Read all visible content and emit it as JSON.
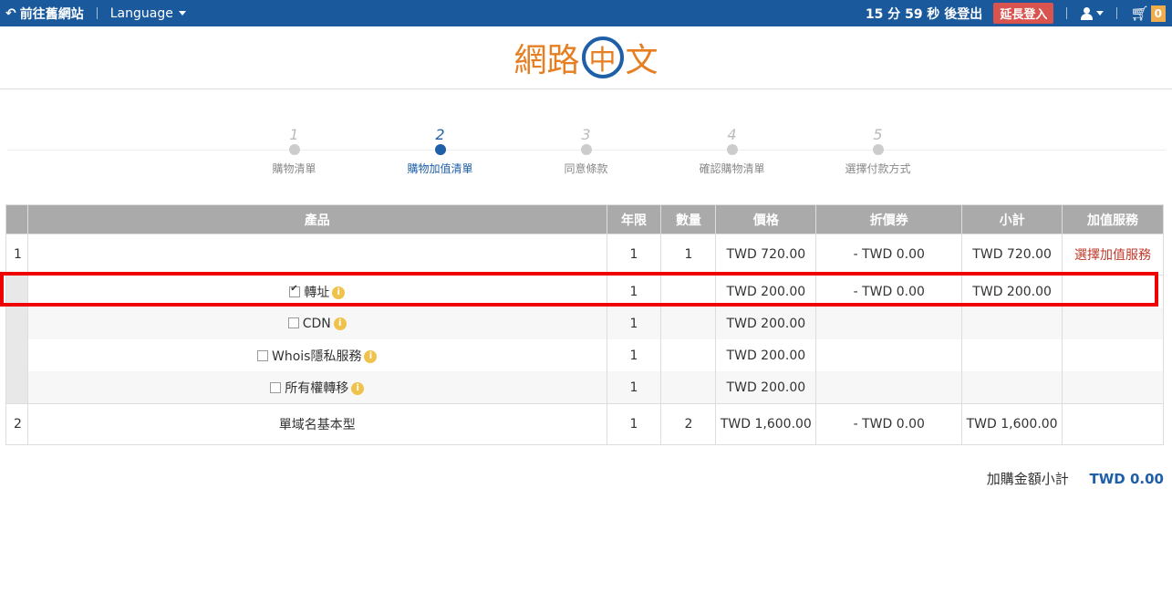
{
  "topbar": {
    "back_label": "前往舊網站",
    "language_label": "Language",
    "timer_text": "15 分 59 秒 後登出",
    "extend_label": "延長登入",
    "cart_count": "0"
  },
  "logo": {
    "left": "網路",
    "mid": "中",
    "right": "文"
  },
  "steps": [
    {
      "num": "1",
      "label": "購物清單"
    },
    {
      "num": "2",
      "label": "購物加值清單"
    },
    {
      "num": "3",
      "label": "同意條款"
    },
    {
      "num": "4",
      "label": "確認購物清單"
    },
    {
      "num": "5",
      "label": "選擇付款方式"
    }
  ],
  "table": {
    "headers": [
      "產品",
      "年限",
      "數量",
      "價格",
      "折價券",
      "小計",
      "加值服務"
    ],
    "rows": [
      {
        "idx": "1",
        "product": "",
        "years": "1",
        "qty": "1",
        "price": "TWD 720.00",
        "coupon": "- TWD 0.00",
        "subtotal": "TWD 720.00",
        "service": "選擇加值服務"
      },
      {
        "idx": "2",
        "product": "單域名基本型",
        "years": "1",
        "qty": "2",
        "price": "TWD 1,600.00",
        "coupon": "- TWD 0.00",
        "subtotal": "TWD 1,600.00",
        "service": ""
      }
    ],
    "addons": [
      {
        "name": "轉址",
        "checked": true,
        "years": "1",
        "price": "TWD 200.00",
        "coupon": "- TWD 0.00",
        "subtotal": "TWD 200.00"
      },
      {
        "name": "CDN",
        "checked": false,
        "years": "1",
        "price": "TWD 200.00",
        "coupon": "",
        "subtotal": ""
      },
      {
        "name": "Whois隱私服務",
        "checked": false,
        "years": "1",
        "price": "TWD 200.00",
        "coupon": "",
        "subtotal": ""
      },
      {
        "name": "所有權轉移",
        "checked": false,
        "years": "1",
        "price": "TWD 200.00",
        "coupon": "",
        "subtotal": ""
      }
    ]
  },
  "total": {
    "label": "加購金額小計",
    "amount": "TWD 0.00"
  },
  "colors": {
    "topbar": "#1a5a9c",
    "accent": "#1e5fa8",
    "logo_orange": "#e67e22",
    "highlight": "#e00000"
  }
}
